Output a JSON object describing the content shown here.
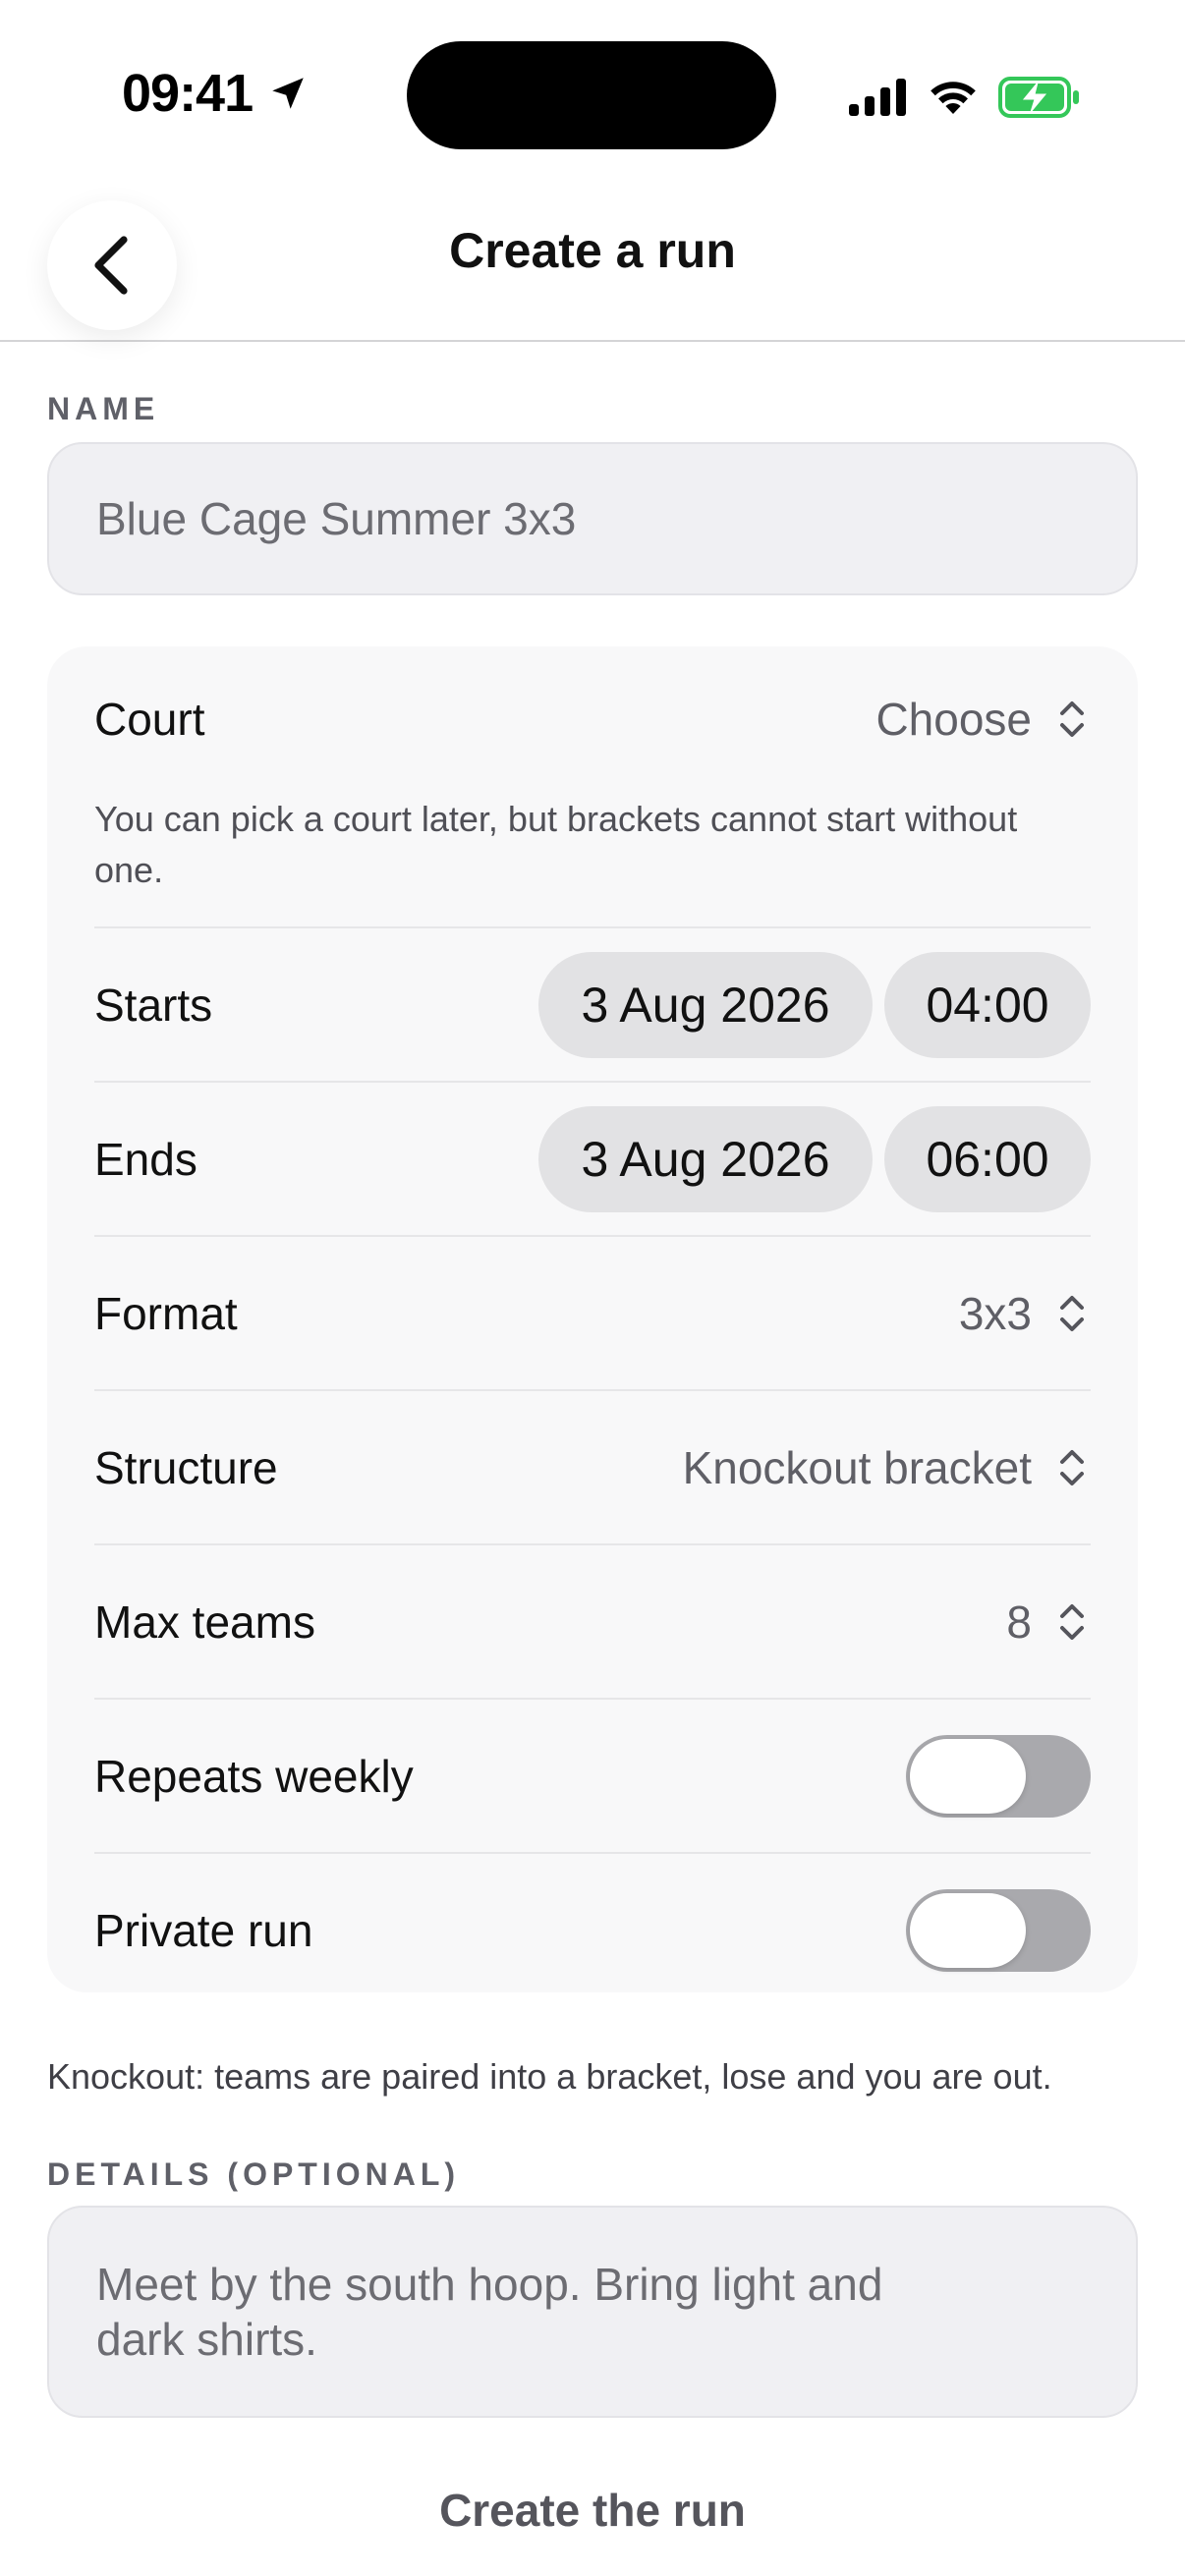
{
  "status_bar": {
    "time": "09:41",
    "icons": [
      "location-arrow-icon",
      "cellular-signal-icon",
      "wifi-icon",
      "battery-charging-icon"
    ],
    "battery_color": "#34c759"
  },
  "nav": {
    "title": "Create a run",
    "back_icon": "chevron-left-icon"
  },
  "name_section": {
    "label": "NAME",
    "value": "Blue Cage Summer 3x3"
  },
  "settings": {
    "court": {
      "label": "Court",
      "value": "Choose",
      "hint": "You can pick a court later, but brackets cannot start without one."
    },
    "starts": {
      "label": "Starts",
      "date": "3 Aug 2026",
      "time": "04:00"
    },
    "ends": {
      "label": "Ends",
      "date": "3 Aug 2026",
      "time": "06:00"
    },
    "format": {
      "label": "Format",
      "value": "3x3"
    },
    "structure": {
      "label": "Structure",
      "value": "Knockout bracket"
    },
    "max_teams": {
      "label": "Max teams",
      "value": "8"
    },
    "repeats_weekly": {
      "label": "Repeats weekly",
      "on": false
    },
    "private_run": {
      "label": "Private run",
      "on": false
    }
  },
  "footnote": "Knockout: teams are paired into a bracket, lose and you are out.",
  "details_section": {
    "label": "DETAILS (OPTIONAL)",
    "placeholder_line1": "Meet by the south hoop. Bring light and",
    "placeholder_line2": "dark shirts."
  },
  "actions": {
    "create_label": "Create the run"
  }
}
